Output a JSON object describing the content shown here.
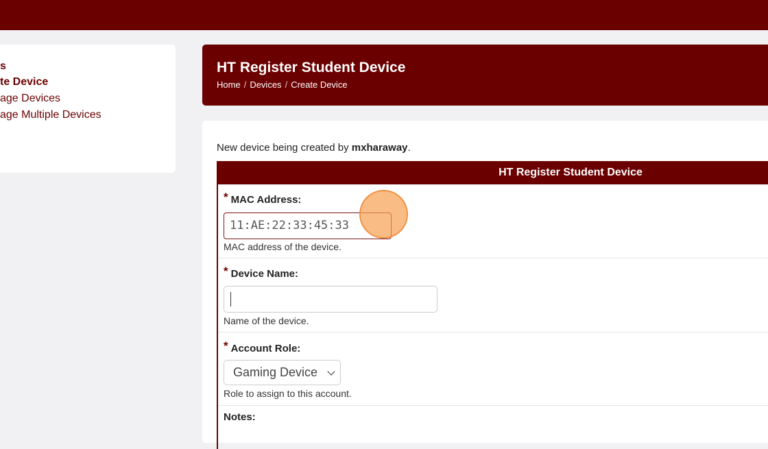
{
  "sidebar": {
    "items": [
      {
        "label": "s",
        "active": true
      },
      {
        "label": "te Device",
        "active": true
      },
      {
        "label": "age Devices",
        "active": false
      },
      {
        "label": "age Multiple Devices",
        "active": false
      }
    ]
  },
  "header": {
    "title": "HT Register Student Device",
    "breadcrumb": [
      "Home",
      "Devices",
      "Create Device"
    ]
  },
  "main": {
    "intro_prefix": "New device being created by ",
    "intro_user": "mxharaway",
    "intro_suffix": ".",
    "table_title": "HT Register Student Device",
    "fields": {
      "mac": {
        "label": "MAC Address:",
        "value": "11:AE:22:33:45:33",
        "help": "MAC address of the device."
      },
      "name": {
        "label": "Device Name:",
        "value": "",
        "help": "Name of the device."
      },
      "role": {
        "label": "Account Role:",
        "selected": "Gaming Device",
        "help": "Role to assign to this account."
      },
      "notes": {
        "label": "Notes:"
      }
    },
    "required_mark": "*"
  },
  "colors": {
    "brand": "#6b0000",
    "click_marker": "#f7a050"
  }
}
